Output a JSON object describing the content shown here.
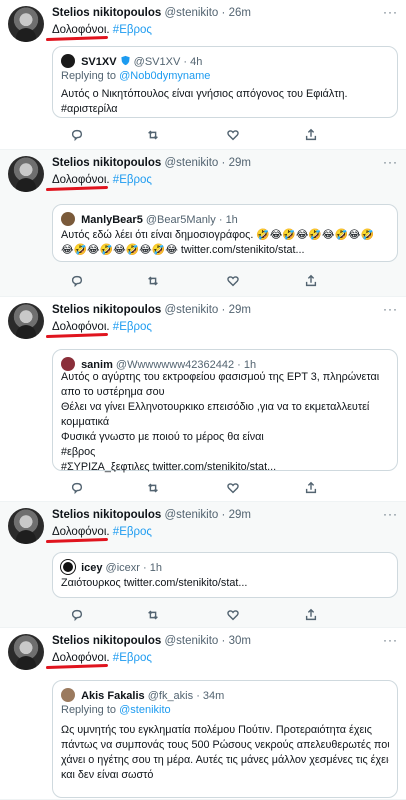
{
  "author": {
    "name": "Stelios nikitopoulos",
    "handle": "@stenikito",
    "dot": "·",
    "more": "···"
  },
  "colors": {
    "accent": "#1d9bf0",
    "underline": "#e0141e",
    "muted": "#536471"
  },
  "tweets": [
    {
      "time": "26m",
      "text": "Δολοφόνοι.",
      "hashtag": "#Εβρος",
      "quote": {
        "name": "SV1XV",
        "handle": "@SV1XV",
        "time": "4h",
        "replying_prefix": "Replying to",
        "replying_to": "@Nob0dymyname",
        "lines": [
          "Αυτός ο Νικητόπουλος είναι γνήσιος απόγονος του Εφιάλτη.",
          "#αριστερίλα"
        ]
      }
    },
    {
      "time": "29m",
      "text": "Δολοφόνοι.",
      "hashtag": "#Εβρος",
      "quote": {
        "name": "ManlyBear5",
        "handle": "@Bear5Manly",
        "time": "1h",
        "lines": [
          "Αυτός εδώ λέει ότι είναι δημοσιογράφος. 🤣😂🤣😂🤣😂🤣😂🤣",
          "😂🤣😂🤣😂🤣😂🤣😂 twitter.com/stenikito/stat..."
        ]
      }
    },
    {
      "time": "29m",
      "text": "Δολοφόνοι.",
      "hashtag": "#Εβρος",
      "quote": {
        "name": "sanim",
        "handle": "@Wwwwwww42362442",
        "time": "1h",
        "lines": [
          "Αυτός ο αγύρτης του εκτροφείου φασισμού της ΕΡΤ 3, πληρώνεται",
          "απο το υστέρημα σου",
          " Θέλει να γίνει  Ελληνοτουρκικο επεισόδιο ,για να το εκμεταλλευτεί",
          "κομματικά",
          "Φυσικά γνωστο με ποιού το μέρος θα είναι",
          "#εβρος",
          "#ΣΥΡΙΖΑ_ξεφτιλες twitter.com/stenikito/stat..."
        ]
      }
    },
    {
      "time": "29m",
      "text": "Δολοφόνοι.",
      "hashtag": "#Εβρος",
      "quote": {
        "name": "icey",
        "handle": "@icexr",
        "time": "1h",
        "lines": [
          "Ζαιότουρκος twitter.com/stenikito/stat..."
        ]
      }
    },
    {
      "time": "30m",
      "text": "Δολοφόνοι.",
      "hashtag": "#Εβρος",
      "quote": {
        "name": "Akis Fakalis",
        "handle": "@fk_akis",
        "time": "34m",
        "replying_prefix": "Replying to",
        "replying_to": "@stenikito",
        "lines": [
          "Ως υμνητής του εγκληματία πολέμου Πούτιν. Προτεραιότητα έχεις",
          "πάντως να συμπονάς τους 500 Ρώσους νεκρούς απελευθερωτές που",
          "χάνει ο ηγέτης σου τη μέρα. Αυτές τις μάνες μάλλον χεσμένες τις έχεις,",
          "και δεν είναι σωστό"
        ]
      }
    }
  ]
}
